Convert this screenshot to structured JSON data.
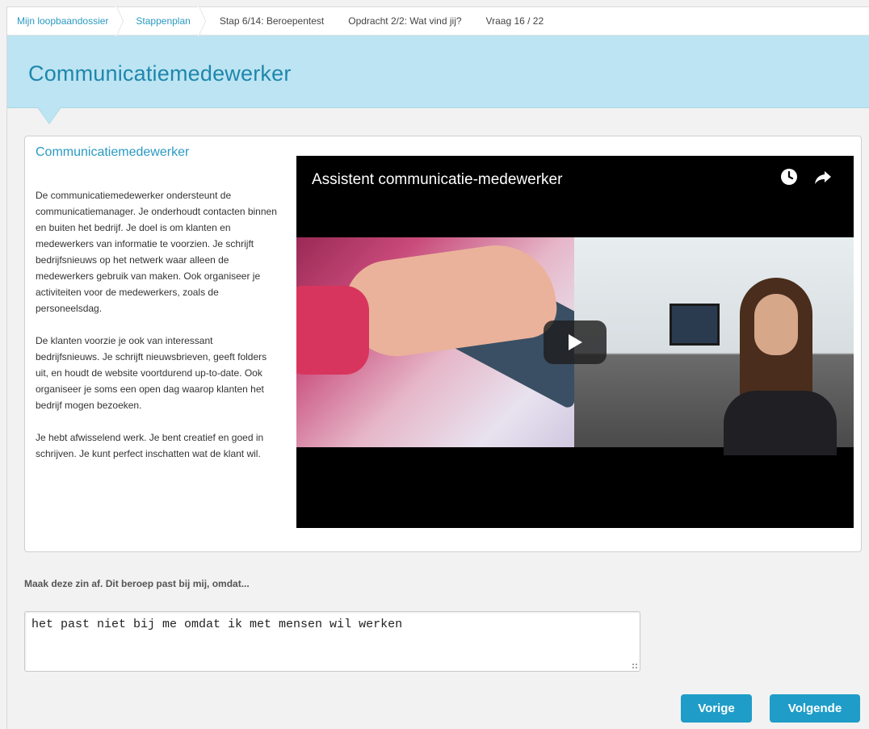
{
  "breadcrumb": {
    "items": [
      {
        "label": "Mijn loopbaandossier",
        "link": true
      },
      {
        "label": "Stappenplan",
        "link": true
      },
      {
        "label": "Stap 6/14: Beroepentest",
        "link": false
      },
      {
        "label": "Opdracht 2/2: Wat vind jij?",
        "link": false
      },
      {
        "label": "Vraag 16 / 22",
        "link": false
      }
    ]
  },
  "header": {
    "title": "Communicatiemedewerker",
    "band_color": "#bde4f2",
    "title_color": "#1e87ad"
  },
  "card": {
    "title": "Communicatiemedewerker",
    "paragraphs": [
      "De communicatiemedewerker ondersteunt de communicatiemanager. Je onderhoudt contacten binnen en buiten het bedrijf. Je doel is om klanten en medewerkers van informatie te voorzien. Je schrijft bedrijfsnieuws op het netwerk waar alleen de medewerkers gebruik van maken. Ook organiseer je activiteiten voor de medewerkers, zoals de personeelsdag.",
      "De klanten voorzie je ook van interessant bedrijfsnieuws. Je schrijft nieuwsbrieven, geeft folders uit, en houdt de website voortdurend up-to-date. Ook organiseer je soms een open dag waarop klanten het bedrijf mogen bezoeken.",
      "Je hebt afwisselend werk. Je bent creatief en goed in schrijven. Je kunt perfect inschatten wat de klant wil."
    ]
  },
  "video": {
    "title": "Assistent communicatie-medewerker",
    "icons": [
      "clock-icon",
      "share-icon",
      "play-icon"
    ]
  },
  "question": {
    "prompt": "Maak deze zin af. Dit beroep past bij mij, omdat...",
    "answer": "het past niet bij me omdat ik met mensen wil werken"
  },
  "nav": {
    "prev_label": "Vorige",
    "next_label": "Volgende",
    "button_color": "#1f9dc8"
  }
}
